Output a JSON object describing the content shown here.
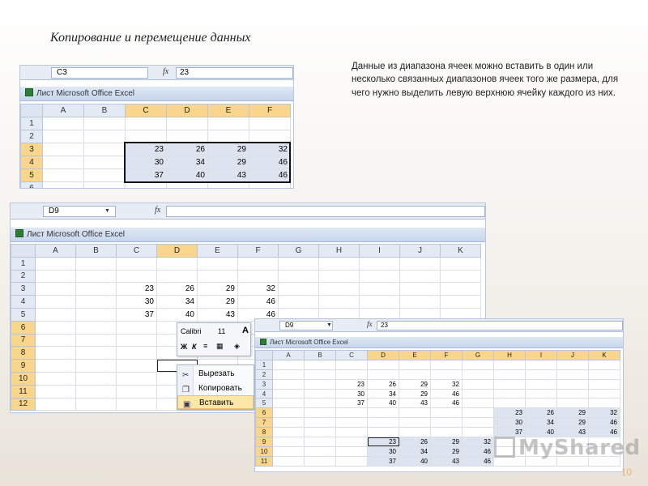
{
  "slide": {
    "title": "Копирование и перемещение данных",
    "description": "Данные из диапазона ячеек можно вставить в один или несколько связанных диапазонов ячеек того же размера, для чего нужно выделить левую верхнюю ячейку каждого из них.",
    "page_number": "10",
    "watermark": "MyShared"
  },
  "window_title": "Лист Microsoft Office Excel",
  "fx_label": "fx",
  "columns": [
    "A",
    "B",
    "C",
    "D",
    "E",
    "F",
    "G",
    "H",
    "I",
    "J",
    "K"
  ],
  "source_values": [
    [
      23,
      26,
      29,
      32
    ],
    [
      30,
      34,
      29,
      46
    ],
    [
      37,
      40,
      43,
      46
    ]
  ],
  "window1": {
    "name_box": "C3",
    "formula": "23"
  },
  "window2": {
    "name_box": "D9",
    "formula": ""
  },
  "window3": {
    "name_box": "D9",
    "formula": "23"
  },
  "mini_toolbar": {
    "font": "Calibri",
    "size": "11",
    "bold": "Ж",
    "italic": "К",
    "grow_font": "A"
  },
  "context_menu": {
    "items": [
      "Вырезать",
      "Копировать",
      "Вставить"
    ]
  }
}
